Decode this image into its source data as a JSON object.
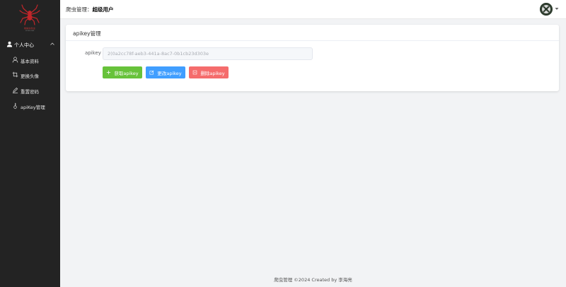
{
  "sidebar": {
    "logo_text": "蜘蛛侠爬虫",
    "logo_subtext": "SPIDER MAN",
    "group": {
      "label": "个人中心",
      "icon": "user-icon"
    },
    "items": [
      {
        "label": "基本资料",
        "icon": "user-outline-icon"
      },
      {
        "label": "更换头像",
        "icon": "crop-icon"
      },
      {
        "label": "重置密码",
        "icon": "edit-pen-icon"
      },
      {
        "label": "apiKey管理",
        "icon": "key-icon"
      }
    ]
  },
  "header": {
    "crumb_prefix": "爬虫管理：",
    "crumb_user": "超级用户"
  },
  "card": {
    "title": "apikey管理",
    "field_label": "apikey",
    "field_value": "2(0a2cc78f-aeb3-441a-8ac7-0b1cb23d303e"
  },
  "buttons": {
    "get": "获取apikey",
    "update": "更改apikey",
    "delete": "删除apikey"
  },
  "footer": "爬虫管理 ©2024 Created by 李海亮",
  "colors": {
    "sidebar_bg": "#232323",
    "green": "#67c23a",
    "blue": "#409eff",
    "red": "#f56c6c"
  }
}
